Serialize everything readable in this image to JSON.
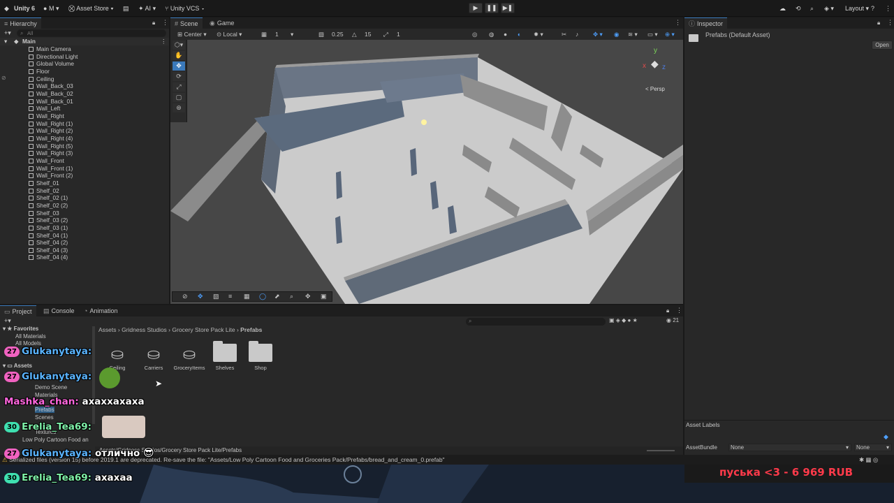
{
  "toolbar": {
    "app": "Unity 6",
    "account": "M",
    "asset_store": "Asset Store",
    "ai": "AI",
    "vcs": "Unity VCS",
    "layout": "Layout"
  },
  "hierarchy": {
    "tab": "Hierarchy",
    "search_placeholder": "All",
    "scene": "Main",
    "items": [
      "Main Camera",
      "Directional Light",
      "Global Volume",
      "Floor",
      "Ceiling",
      "Wall_Back_03",
      "Wall_Back_02",
      "Wall_Back_01",
      "Wall_Left",
      "Wall_Right",
      "Wall_Right (1)",
      "Wall_Right (2)",
      "Wall_Right (4)",
      "Wall_Right (5)",
      "Wall_Right (3)",
      "Wall_Front",
      "Wall_Front (1)",
      "Wall_Front (2)",
      "Shelf_01",
      "Shelf_02",
      "Shelf_02 (1)",
      "Shelf_02 (2)",
      "Shelf_03",
      "Shelf_03 (2)",
      "Shelf_03 (1)",
      "Shelf_04 (1)",
      "Shelf_04 (2)",
      "Shelf_04 (3)",
      "Shelf_04 (4)"
    ]
  },
  "scene": {
    "tab_scene": "Scene",
    "tab_game": "Game",
    "pivot": "Center",
    "space": "Local",
    "grid_value": "1",
    "snap_value": "0.25",
    "angle_value": "15",
    "scale_value": "1",
    "persp": "< Persp"
  },
  "inspector": {
    "tab": "Inspector",
    "title": "Prefabs (Default Asset)",
    "open_button": "Open",
    "asset_labels": "Asset Labels",
    "asset_bundle_label": "AssetBundle",
    "asset_bundle_value": "None",
    "variant_value": "None"
  },
  "project": {
    "tab_project": "Project",
    "tab_console": "Console",
    "tab_animation": "Animation",
    "breadcrumb": [
      "Assets",
      "Gridness Studios",
      "Grocery Store Pack Lite",
      "Prefabs"
    ],
    "favorites_label": "Favorites",
    "favorites": [
      "All Materials",
      "All Models"
    ],
    "assets_label": "Assets",
    "tree": [
      "Demo Scene",
      "Materials",
      "Prefabs",
      "Scenes",
      "Textures",
      "Low Poly Cartoon Food an"
    ],
    "assets": [
      "Ceiling",
      "Carriers",
      "GroceryItems",
      "Shelves",
      "Shop"
    ],
    "count": "21",
    "path": "Assets/Gridness Studios/Grocery Store Pack Lite/Prefabs"
  },
  "status": {
    "text": "Serialized files (version 15) before 2019.1 are deprecated. Re-save the file: \"Assets/Low Poly Cartoon Food and Groceries Pack/Prefabs/bread_and_cream_0.prefab\""
  },
  "chat": [
    {
      "badge": "27",
      "user": "Glukanytaya:",
      "message": "",
      "badge_color": "#f062c0",
      "name_color": "#5ab4ff"
    },
    {
      "badge": "27",
      "user": "Glukanytaya:",
      "message": "",
      "badge_color": "#f062c0",
      "name_color": "#5ab4ff"
    },
    {
      "badge": "",
      "user": "Mashka_chan:",
      "message": "ахаххахаха",
      "badge_color": "",
      "name_color": "#ff66dd"
    },
    {
      "badge": "30",
      "user": "Erelia_Tea69:",
      "message": "",
      "badge_color": "#3fe0b0",
      "name_color": "#7ef0a8"
    },
    {
      "badge": "27",
      "user": "Glukanytaya:",
      "message": "отлично",
      "badge_color": "#f062c0",
      "name_color": "#5ab4ff"
    },
    {
      "badge": "30",
      "user": "Erelia_Tea69:",
      "message": "ахахаа",
      "badge_color": "#3fe0b0",
      "name_color": "#7ef0a8"
    }
  ],
  "donation": "пуська <3 - 6 969 RUB",
  "colors": {
    "accent": "#3a79bb",
    "donation": "#ff3a4a"
  }
}
